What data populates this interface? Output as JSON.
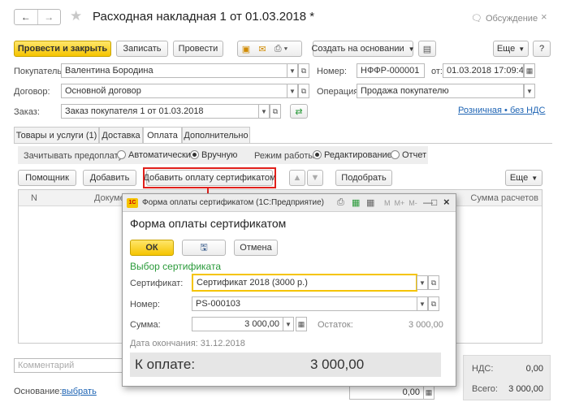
{
  "window": {
    "title": "Расходная накладная 1 от 01.03.2018 *",
    "discussion": "Обсуждение"
  },
  "toolbar": {
    "post_close": "Провести и закрыть",
    "save": "Записать",
    "post": "Провести",
    "create_based": "Создать на основании",
    "more": "Еще",
    "help": "?"
  },
  "header": {
    "buyer_label": "Покупатель:",
    "buyer_value": "Валентина Бородина",
    "number_label": "Номер:",
    "number_value": "НФФР-000001",
    "from_label": "от:",
    "date_value": "01.03.2018 17:09:47",
    "contract_label": "Договор:",
    "contract_value": "Основной договор",
    "operation_label": "Операция:",
    "operation_value": "Продажа покупателю",
    "order_label": "Заказ:",
    "order_value": "Заказ покупателя 1 от 01.03.2018",
    "price_link": "Розничная • без НДС"
  },
  "tabs": [
    {
      "label": "Товары и услуги (1)"
    },
    {
      "label": "Доставка"
    },
    {
      "label": "Оплата"
    },
    {
      "label": "Дополнительно"
    }
  ],
  "payment": {
    "prepay_label": "Зачитывать предоплату:",
    "auto": "Автоматически",
    "manual": "Вручную",
    "mode_label": "Режим работы:",
    "edit": "Редактирование",
    "report": "Отчет",
    "assistant": "Помощник",
    "add": "Добавить",
    "add_cert": "Добавить оплату сертификатом",
    "select": "Подобрать",
    "more": "Еще",
    "col_n": "N",
    "col_doc": "Докуме",
    "col_sum": "Сумма расчетов"
  },
  "footer": {
    "comment_placeholder": "Комментарий",
    "basis_label": "Основание:",
    "basis_link": "выбрать",
    "vat_label": "НДС:",
    "vat_value": "0,00",
    "total_label": "Всего:",
    "total_value": "3 000,00",
    "hidden_value": "0,00"
  },
  "dialog": {
    "titlebar": "Форма оплаты сертификатом (1С:Предприятие)",
    "titlebar_tools": "M  M+  M-",
    "heading": "Форма оплаты сертификатом",
    "ok": "ОК",
    "cancel": "Отмена",
    "section": "Выбор сертификата",
    "cert_label": "Сертификат:",
    "cert_value": "Сертификат 2018 (3000 р.)",
    "num_label": "Номер:",
    "num_value": "PS-000103",
    "sum_label": "Сумма:",
    "sum_value": "3 000,00",
    "rest_label": "Остаток:",
    "rest_value": "3 000,00",
    "end_date": "Дата окончания: 31.12.2018",
    "to_pay_label": "К оплате:",
    "to_pay_value": "3 000,00"
  },
  "colors": {
    "accent_yellow": "#f5c400",
    "highlight_red": "#e0201b",
    "link_blue": "#1e64b4",
    "section_green": "#2a9a3a"
  }
}
